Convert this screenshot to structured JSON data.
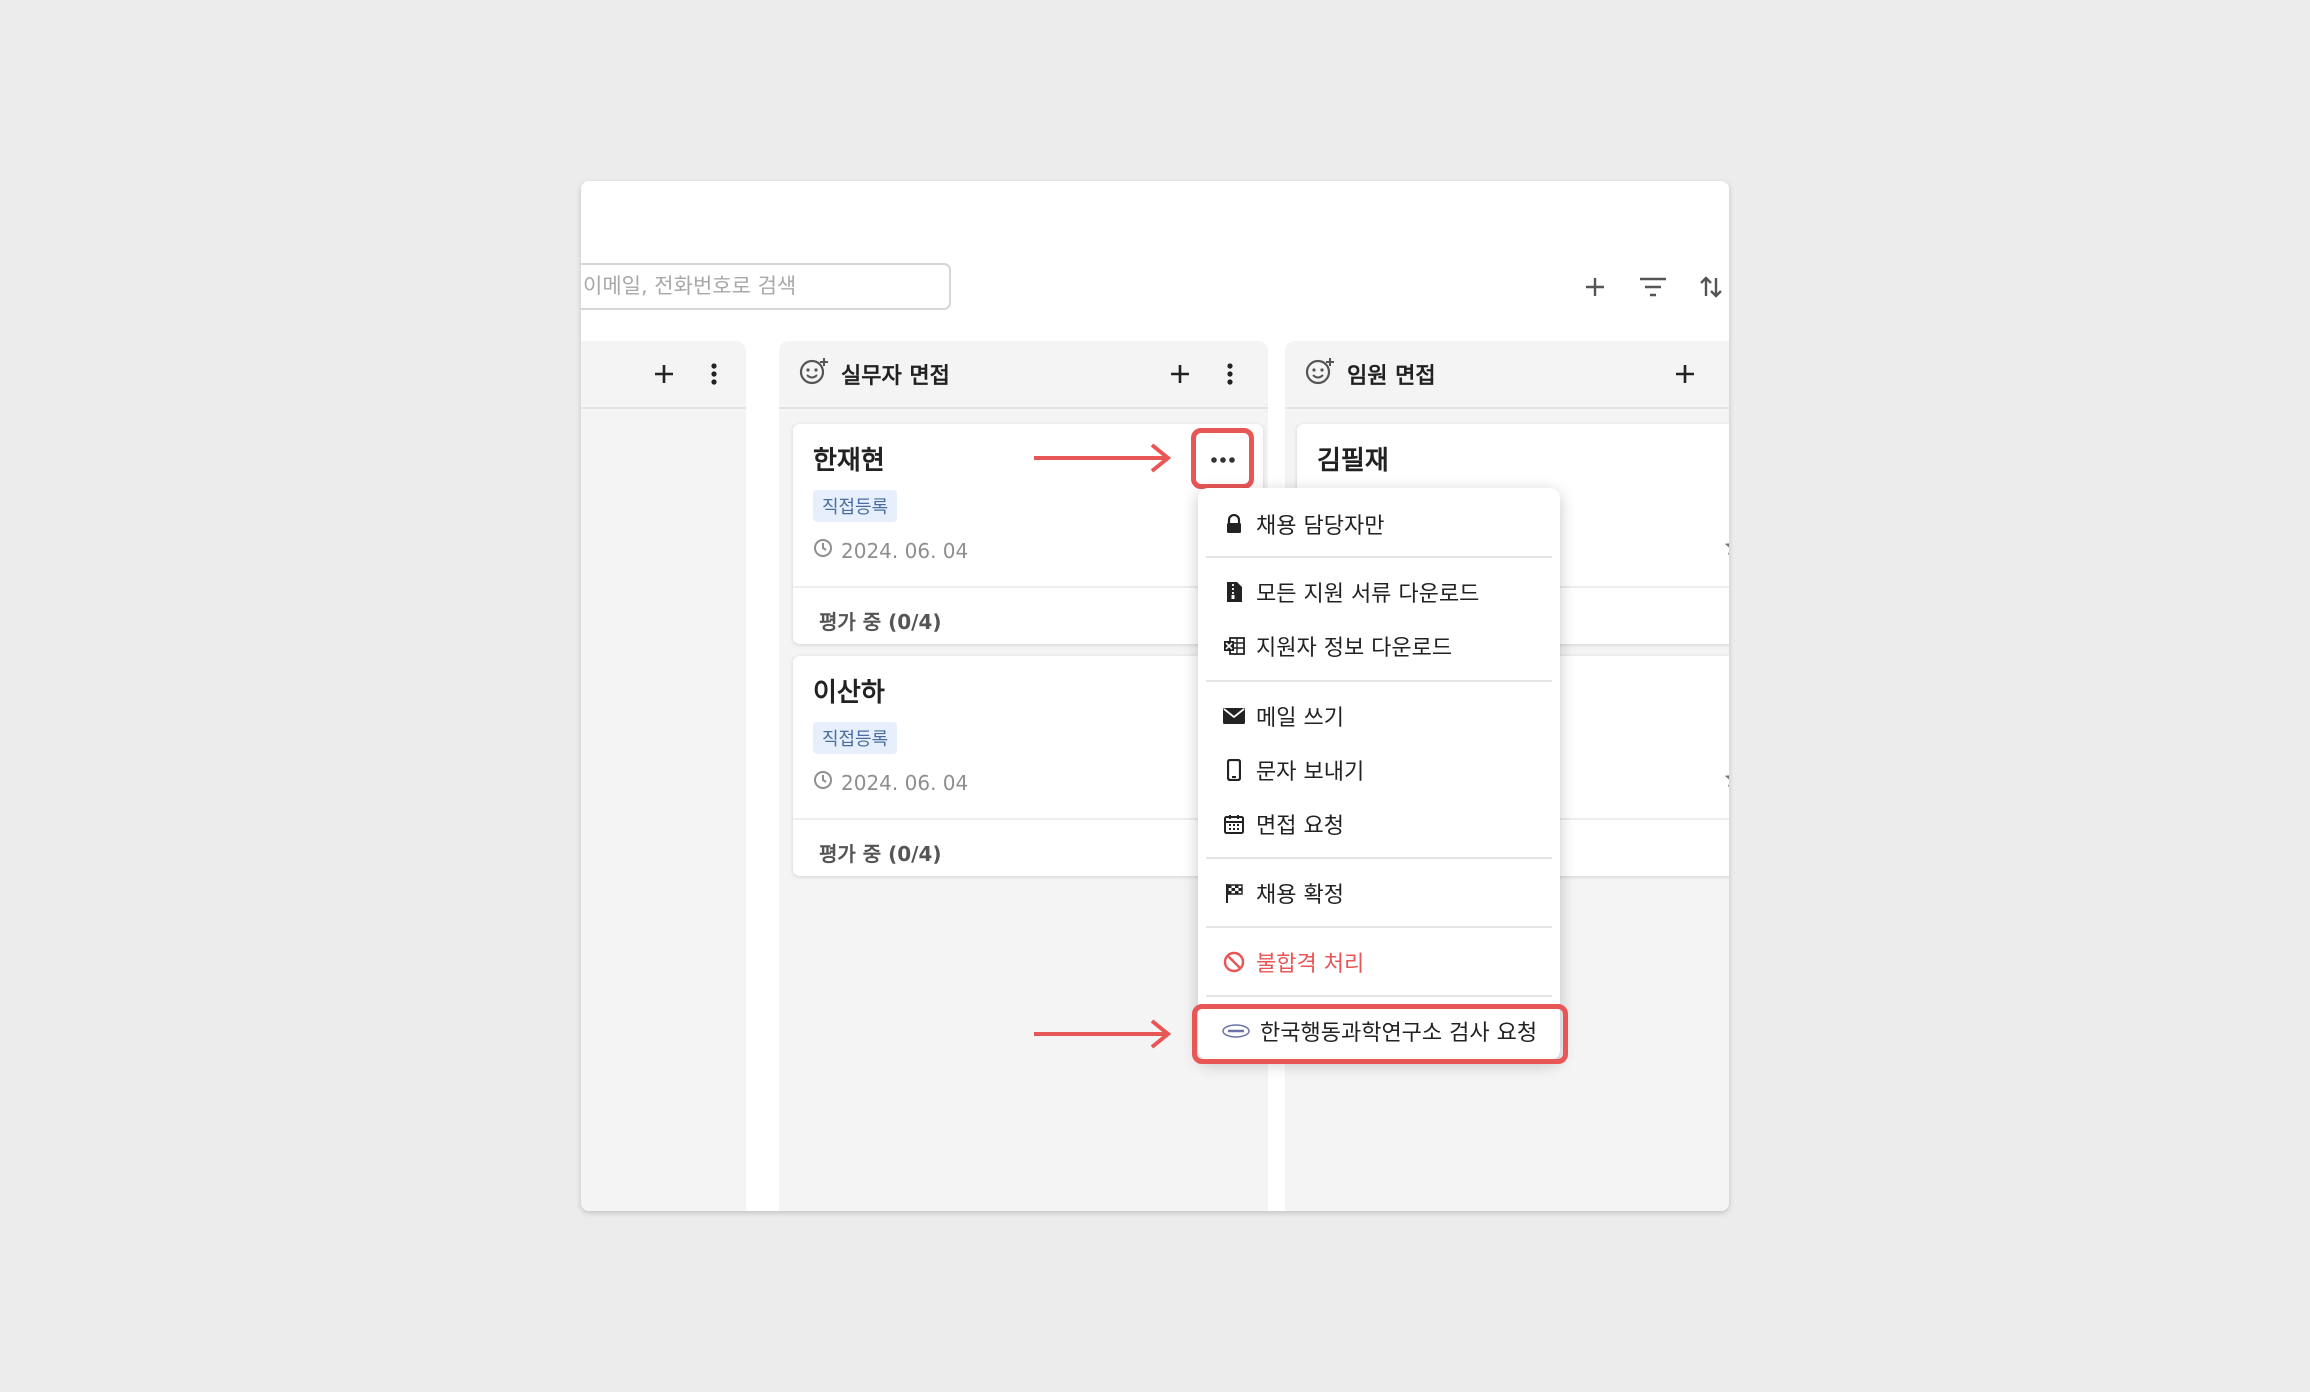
{
  "toolbar": {
    "search_placeholder": "이메일, 전화번호로 검색",
    "add_icon": "plus-icon",
    "filter_icon": "filter-icon",
    "sort_icon": "sort-icon"
  },
  "columns": [
    {
      "title": ""
    },
    {
      "title": "실무자 면접"
    },
    {
      "title": "임원 면접"
    }
  ],
  "cards": [
    {
      "name": "한재현",
      "tag": "직접등록",
      "date": "2024. 06. 04",
      "status": "평가 중 (0/4)"
    },
    {
      "name": "이산하",
      "tag": "직접등록",
      "date": "2024. 06. 04",
      "status": "평가 중 (0/4)"
    },
    {
      "name": "김필재"
    }
  ],
  "menu": {
    "items": [
      {
        "label": "채용 담당자만",
        "icon": "lock-icon"
      },
      {
        "label": "모든 지원 서류 다운로드",
        "icon": "file-zip-icon"
      },
      {
        "label": "지원자 정보 다운로드",
        "icon": "excel-icon"
      },
      {
        "label": "메일 쓰기",
        "icon": "mail-icon"
      },
      {
        "label": "문자 보내기",
        "icon": "phone-icon"
      },
      {
        "label": "면접 요청",
        "icon": "calendar-icon"
      },
      {
        "label": "채용 확정",
        "icon": "flag-icon"
      },
      {
        "label": "불합격 처리",
        "icon": "ban-icon",
        "color": "#e95656"
      },
      {
        "label": "한국행동과학연구소 검사 요청",
        "icon": "kirbs-logo-icon"
      }
    ]
  },
  "colors": {
    "highlight": "#e95656",
    "tag_bg": "#e6effb",
    "background": "#ececec"
  }
}
